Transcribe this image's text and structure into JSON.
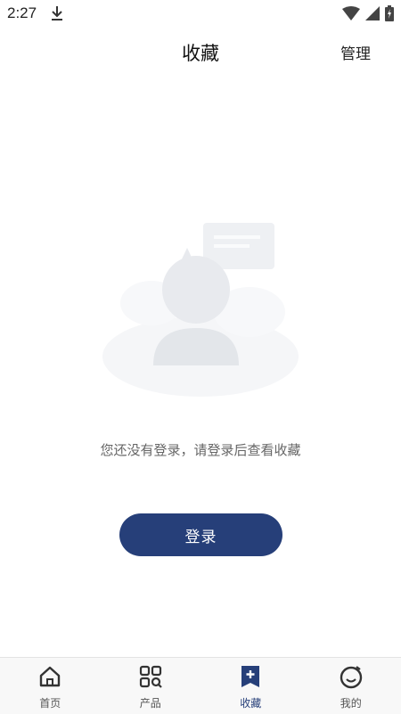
{
  "status_bar": {
    "time": "2:27"
  },
  "header": {
    "title": "收藏",
    "manage_label": "管理"
  },
  "empty_state": {
    "message": "您还没有登录，请登录后查看收藏"
  },
  "login_button": {
    "label": "登录"
  },
  "tab_bar": {
    "tabs": [
      {
        "label": "首页",
        "icon": "home-icon",
        "active": false
      },
      {
        "label": "产品",
        "icon": "products-search-icon",
        "active": false
      },
      {
        "label": "收藏",
        "icon": "favorites-bookmark-icon",
        "active": true
      },
      {
        "label": "我的",
        "icon": "profile-smiley-icon",
        "active": false
      }
    ]
  },
  "colors": {
    "accent": "#263f79",
    "inactive": "#555555",
    "tab_bar_bg": "#f8f8f8"
  }
}
